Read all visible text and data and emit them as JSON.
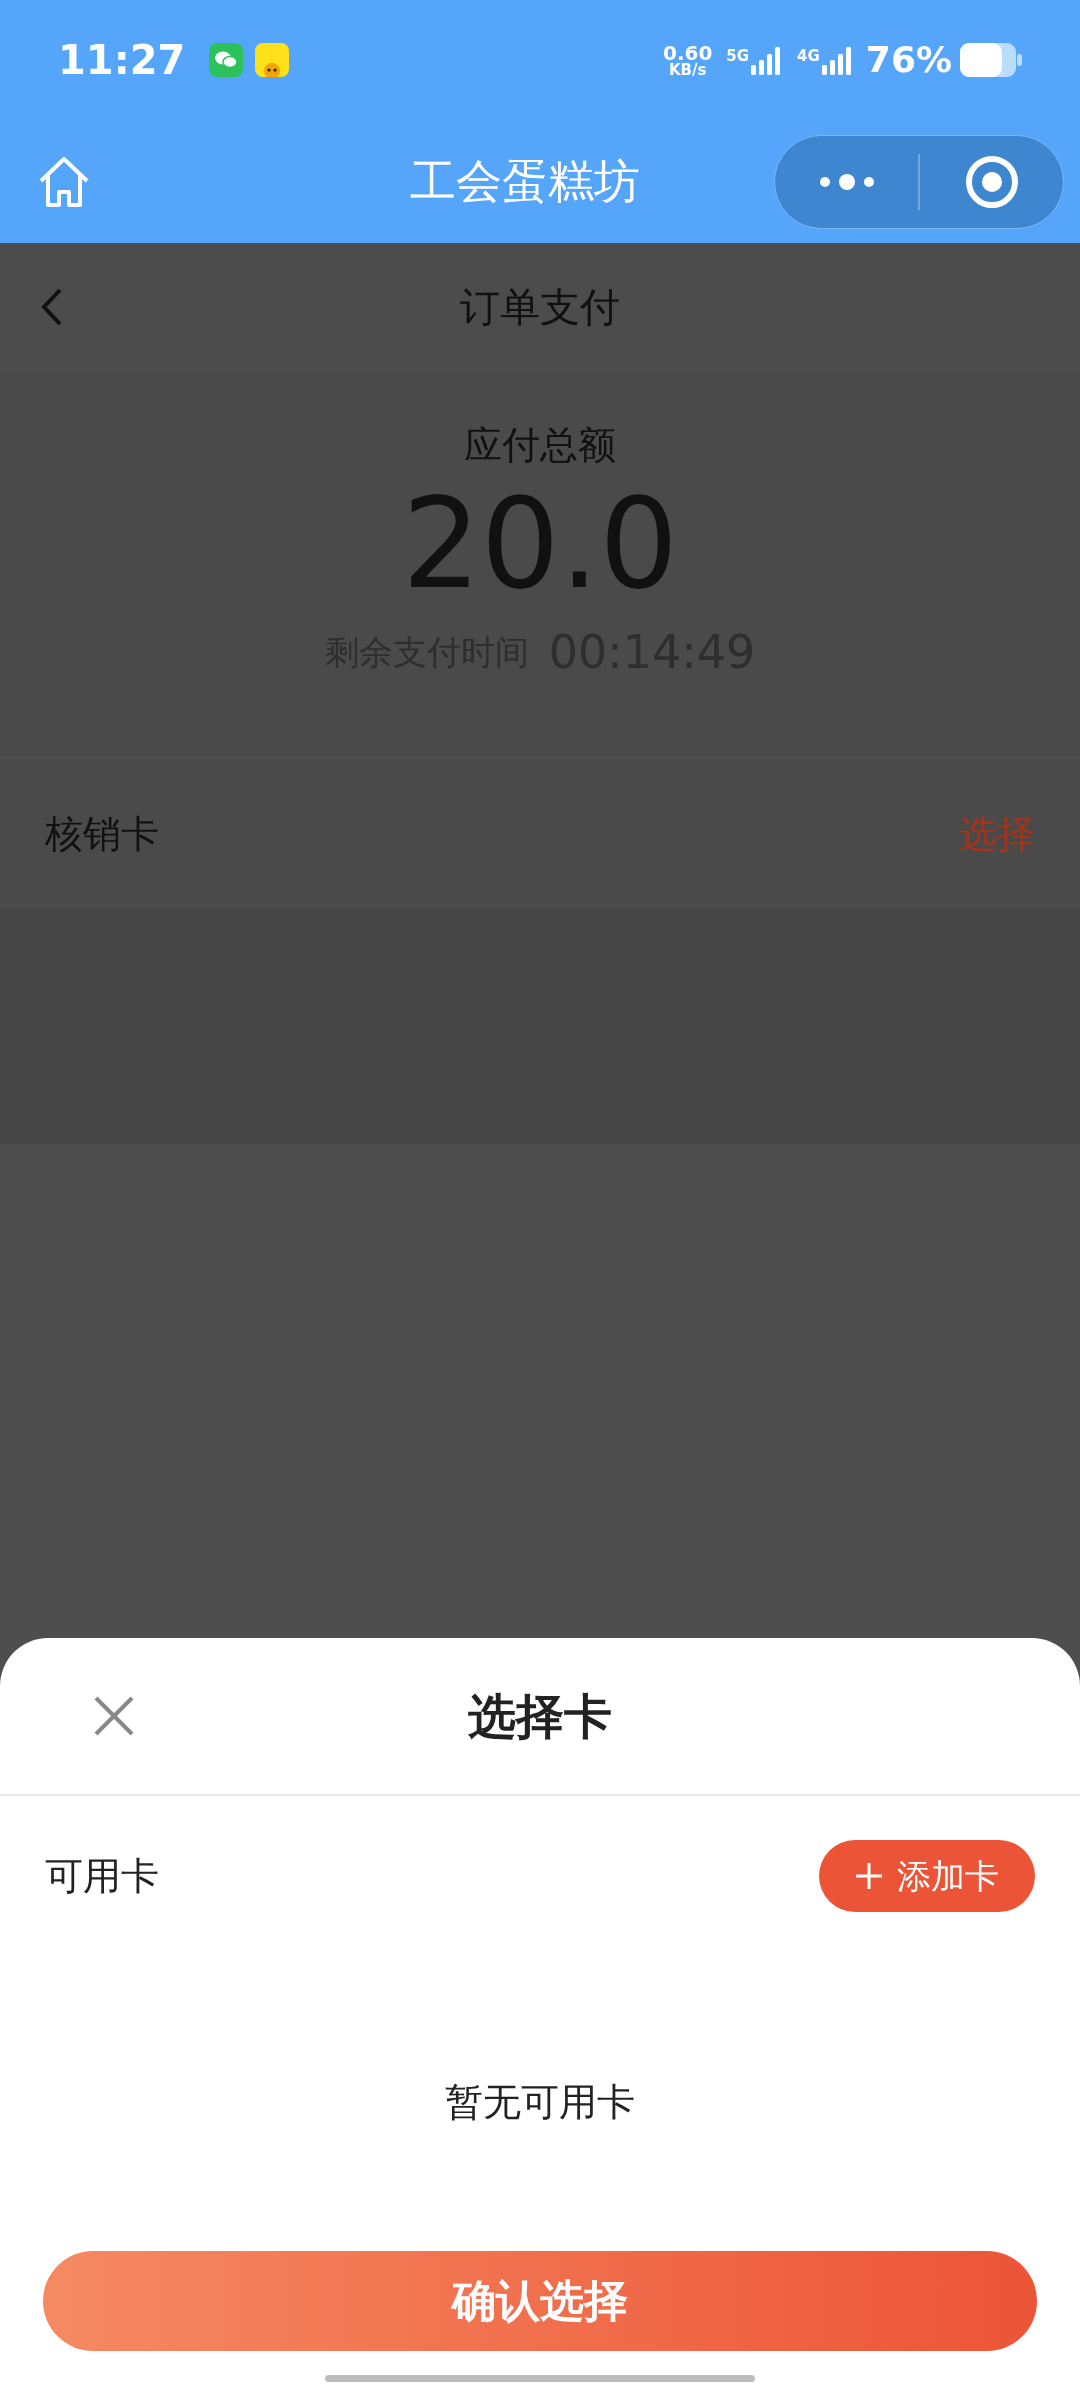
{
  "status_bar": {
    "time": "11:27",
    "net_speed": "0.60",
    "net_unit": "KB/s",
    "signal_1": "5G",
    "signal_2": "4G",
    "battery": "76%"
  },
  "nav_bar": {
    "title": "工会蛋糕坊"
  },
  "page": {
    "title": "订单支付",
    "total_label": "应付总额",
    "amount": "20.0",
    "countdown_label": "剩余支付时间",
    "countdown": "00:14:49",
    "card_row": {
      "label": "核销卡",
      "action": "选择"
    }
  },
  "sheet": {
    "title": "选择卡",
    "section_label": "可用卡",
    "add_button": "添加卡",
    "empty_text": "暂无可用卡",
    "confirm_button": "确认选择"
  }
}
